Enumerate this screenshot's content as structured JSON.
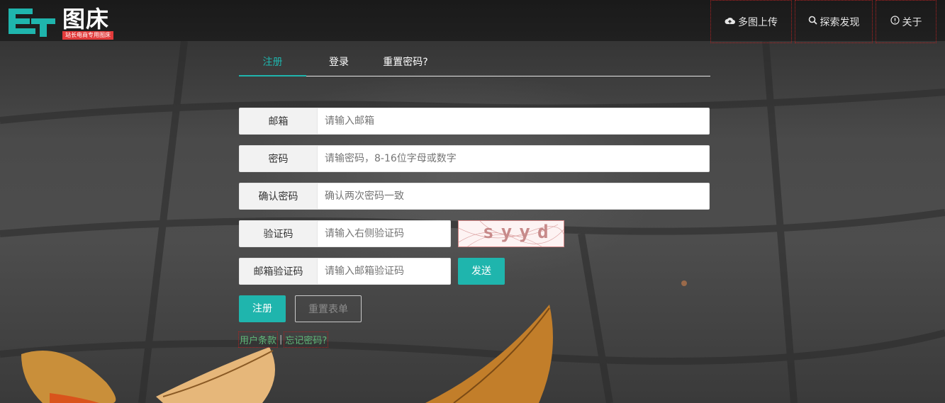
{
  "header": {
    "logo_title": "图床",
    "logo_tagline": "站长电商专用图床",
    "nav": [
      {
        "label": "多图上传",
        "icon": "cloud-upload-icon"
      },
      {
        "label": "探索发现",
        "icon": "search-icon"
      },
      {
        "label": "关于",
        "icon": "info-icon"
      }
    ]
  },
  "tabs": [
    {
      "label": "注册",
      "active": true
    },
    {
      "label": "登录",
      "active": false
    },
    {
      "label": "重置密码?",
      "active": false
    }
  ],
  "form": {
    "email": {
      "label": "邮箱",
      "placeholder": "请输入邮箱",
      "value": ""
    },
    "password": {
      "label": "密码",
      "placeholder": "请输密码，8-16位字母或数字",
      "value": ""
    },
    "confirm": {
      "label": "确认密码",
      "placeholder": "确认两次密码一致",
      "value": ""
    },
    "captcha": {
      "label": "验证码",
      "placeholder": "请输入右侧验证码",
      "value": "",
      "image_text": "syyd"
    },
    "email_code": {
      "label": "邮箱验证码",
      "placeholder": "请输入邮箱验证码",
      "value": "",
      "send_label": "发送"
    }
  },
  "actions": {
    "submit_label": "注册",
    "reset_label": "重置表单"
  },
  "links": {
    "terms": "用户条款",
    "separator": "|",
    "forgot": "忘记密码?"
  },
  "colors": {
    "accent": "#1fb5ad",
    "link": "#5fb878",
    "tag_red": "#e23b3b"
  }
}
